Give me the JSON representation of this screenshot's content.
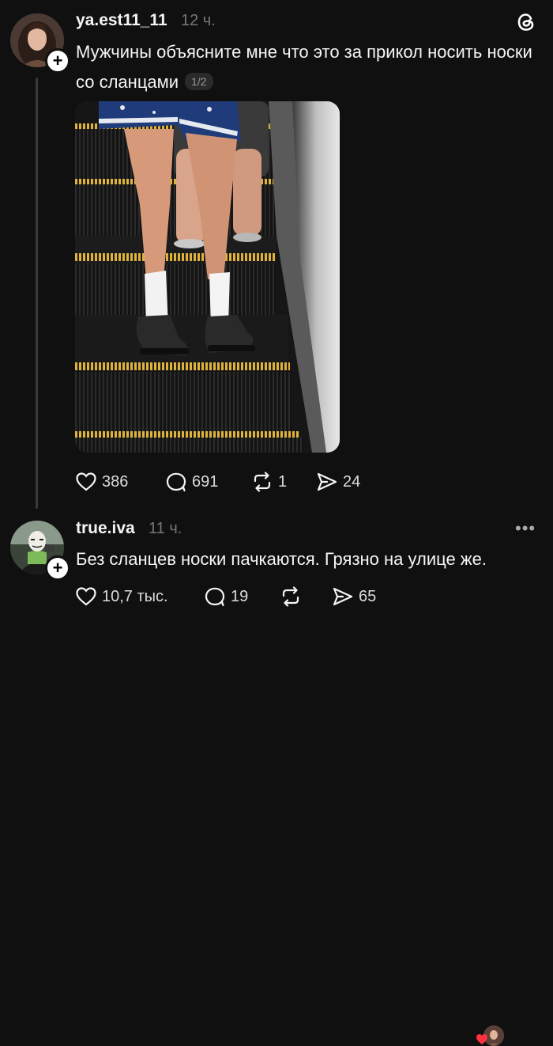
{
  "post": {
    "username": "ya.est11_11",
    "time": "12 ч.",
    "text": "Мужчины объясните мне что это за прикол носить носки со сланцами",
    "page_indicator": "1/2",
    "likes": "386",
    "comments": "691",
    "reposts": "1",
    "shares": "24"
  },
  "reply": {
    "username": "true.iva",
    "time": "11 ч.",
    "text": "Без сланцев носки пачкаются. Грязно на улице же.",
    "likes": "10,7 тыс.",
    "comments": "19",
    "reposts": "",
    "shares": "65"
  },
  "icons": {
    "logo": "threads-logo-icon",
    "like": "heart-icon",
    "comment": "comment-bubble-icon",
    "repost": "repost-icon",
    "share": "send-icon",
    "follow": "plus-icon",
    "more": "more-icon"
  },
  "colors": {
    "background": "#101010",
    "text": "#f3f5f7",
    "muted": "#777777",
    "liked_heart": "#ff3040",
    "stair_edge": "#e0b43a"
  }
}
